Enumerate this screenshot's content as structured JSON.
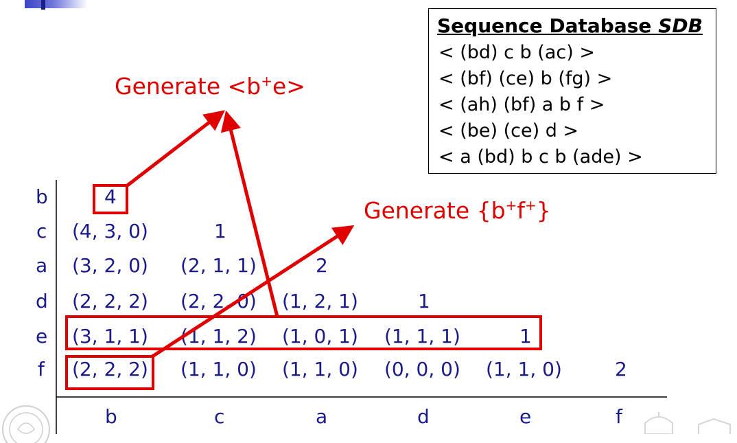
{
  "sdb": {
    "title_prefix": "Sequence Database ",
    "title_emph": "SDB",
    "rows": [
      "< (bd) c b (ac) >",
      "< (bf) (ce) b (fg) >",
      "< (ah) (bf) a b f >",
      "< (be) (ce) d >",
      "< a (bd) b c b (ade) >"
    ]
  },
  "generate_be": {
    "text": "Generate <b",
    "sup": "+",
    "tail": "e>"
  },
  "generate_bf": {
    "text": "Generate {b",
    "sup1": "+",
    "mid": "f",
    "sup2": "+",
    "tail": "}"
  },
  "row_labels": [
    "b",
    "c",
    "a",
    "d",
    "e",
    "f"
  ],
  "col_labels": [
    "b",
    "c",
    "a",
    "d",
    "e",
    "f"
  ],
  "matrix": {
    "b": [
      "4"
    ],
    "c": [
      "(4, 3, 0)",
      "1"
    ],
    "a": [
      "(3, 2, 0)",
      "(2, 1, 1)",
      "2"
    ],
    "d": [
      "(2, 2, 2)",
      "(2, 2, 0)",
      "(1, 2, 1)",
      "1"
    ],
    "e": [
      "(3, 1, 1)",
      "(1, 1, 2)",
      "(1, 0, 1)",
      "(1, 1, 1)",
      "1"
    ],
    "f": [
      "(2, 2, 2)",
      "(1, 1, 0)",
      "(1, 1, 0)",
      "(0, 0, 0)",
      "(1, 1, 0)",
      "2"
    ]
  },
  "colors": {
    "matrix_text": "#1a1a8c",
    "highlight": "#e00000"
  }
}
